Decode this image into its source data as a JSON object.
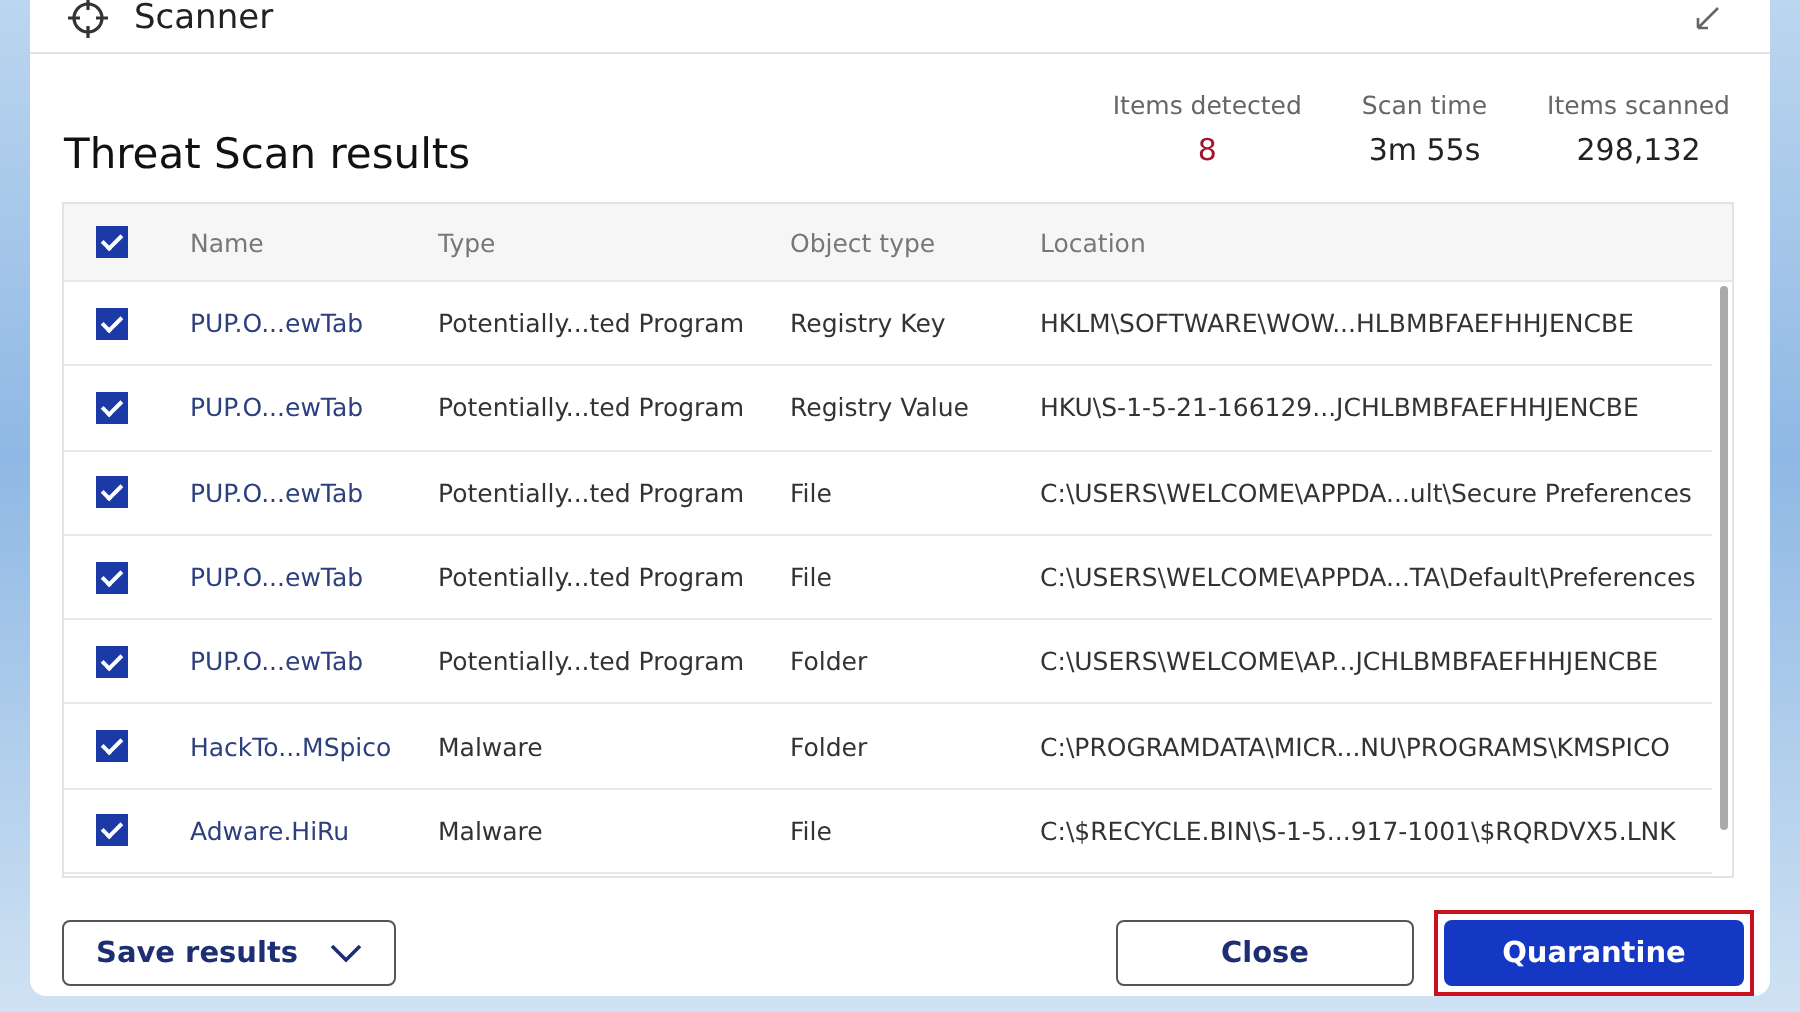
{
  "window": {
    "title": "Scanner"
  },
  "heading": "Threat Scan results",
  "stats": [
    {
      "label": "Items detected",
      "value": "8",
      "kind": "alert"
    },
    {
      "label": "Scan time",
      "value": "3m 55s",
      "kind": "plain"
    },
    {
      "label": "Items scanned",
      "value": "298,132",
      "kind": "plain"
    }
  ],
  "table": {
    "all_checked": true,
    "columns": [
      "Name",
      "Type",
      "Object type",
      "Location"
    ],
    "rows": [
      {
        "checked": true,
        "cells": [
          "PUP.O...ewTab",
          "Potentially...ted Program",
          "Registry Key",
          "HKLM\\SOFTWARE\\WOW...HLBMBFAEFHHJENCBE"
        ]
      },
      {
        "checked": true,
        "cells": [
          "PUP.O...ewTab",
          "Potentially...ted Program",
          "Registry Value",
          "HKU\\S-1-5-21-166129...JCHLBMBFAEFHHJENCBE"
        ]
      },
      {
        "checked": true,
        "cells": [
          "PUP.O...ewTab",
          "Potentially...ted Program",
          "File",
          "C:\\USERS\\WELCOME\\APPDA...ult\\Secure Preferences"
        ]
      },
      {
        "checked": true,
        "cells": [
          "PUP.O...ewTab",
          "Potentially...ted Program",
          "File",
          "C:\\USERS\\WELCOME\\APPDA...TA\\Default\\Preferences"
        ]
      },
      {
        "checked": true,
        "cells": [
          "PUP.O...ewTab",
          "Potentially...ted Program",
          "Folder",
          "C:\\USERS\\WELCOME\\AP...JCHLBMBFAEFHHJENCBE"
        ]
      },
      {
        "checked": true,
        "cells": [
          "HackTo...MSpico",
          "Malware",
          "Folder",
          "C:\\PROGRAMDATA\\MICR...NU\\PROGRAMS\\KMSPICO"
        ]
      },
      {
        "checked": true,
        "cells": [
          "Adware.HiRu",
          "Malware",
          "File",
          "C:\\$RECYCLE.BIN\\S-1-5...917-1001\\$RQRDVX5.LNK"
        ]
      }
    ]
  },
  "footer": {
    "save": "Save results",
    "close": "Close",
    "quarantine": {
      "label": "Quarantine",
      "highlighted": true
    }
  }
}
